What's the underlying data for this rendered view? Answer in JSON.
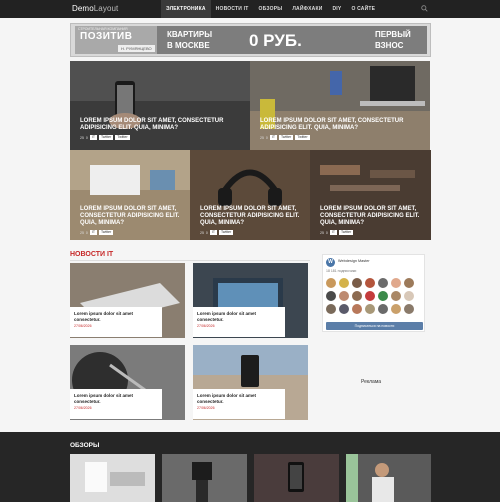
{
  "header": {
    "logo_bold": "Demo",
    "logo_thin": "Layout",
    "nav": [
      "ЭЛЕКТРОНИКА",
      "НОВОСТИ IT",
      "ОБЗОРЫ",
      "ЛАЙФХАКИ",
      "DIY",
      "О САЙТЕ"
    ],
    "search_icon": "search-icon"
  },
  "banner": {
    "small": "СТРОИТЕЛЬНАЯ КОМПАНИЯ",
    "brand": "ПОЗИТИВ",
    "name": "Н. РУМЯНЦЕВО",
    "line1": "КВАРТИРЫ",
    "line2": "В МОСКВЕ",
    "big": "0 РУБ.",
    "right1": "ПЕРВЫЙ",
    "right2": "ВЗНОС"
  },
  "hero": [
    {
      "title": "LOREM IPSUM DOLOR SIT AMET, CONSECTETUR ADIPISICING ELIT. QUIA, MINIMA?",
      "views": "25",
      "likes": "0",
      "tags": [
        "IT",
        "Twitter",
        "Twitter"
      ]
    },
    {
      "title": "LOREM IPSUM DOLOR SIT AMET, CONSECTETUR ADIPISICING ELIT. QUIA, MINIMA?",
      "views": "25",
      "likes": "0",
      "tags": [
        "IT",
        "Twitter",
        "Twitter"
      ]
    },
    {
      "title": "LOREM IPSUM DOLOR SIT AMET, CONSECTETUR ADIPISICING ELIT. QUIA, MINIMA?",
      "views": "25",
      "likes": "0",
      "tags": [
        "IT",
        "Twitter"
      ]
    },
    {
      "title": "LOREM IPSUM DOLOR SIT AMET, CONSECTETUR ADIPISICING ELIT. QUIA, MINIMA?",
      "views": "25",
      "likes": "0",
      "tags": [
        "IT",
        "Twitter"
      ]
    },
    {
      "title": "LOREM IPSUM DOLOR SIT AMET, CONSECTETUR ADIPISICING ELIT. QUIA, MINIMA?",
      "views": "25",
      "likes": "0",
      "tags": [
        "IT",
        "Twitter"
      ]
    }
  ],
  "news": {
    "title": "НОВОСТИ IT",
    "items": [
      {
        "title": "Lorem ipsum dolor sit amet consectetur.",
        "date": "27/06/2026"
      },
      {
        "title": "Lorem ipsum dolor sit amet consectetur.",
        "date": "27/06/2026"
      },
      {
        "title": "Lorem ipsum dolor sit amet consectetur.",
        "date": "27/06/2026"
      },
      {
        "title": "Lorem ipsum dolor sit amet consectetur.",
        "date": "27/06/2026"
      }
    ]
  },
  "widget": {
    "avatar_letter": "W",
    "title": "Webdesign Master",
    "count": "18 181 подписчики",
    "button": "Подписаться на новости",
    "brand_color": "#4a76a8"
  },
  "sidebar": {
    "ad_label": "Реклама"
  },
  "reviews": {
    "title": "ОБЗОРЫ"
  }
}
